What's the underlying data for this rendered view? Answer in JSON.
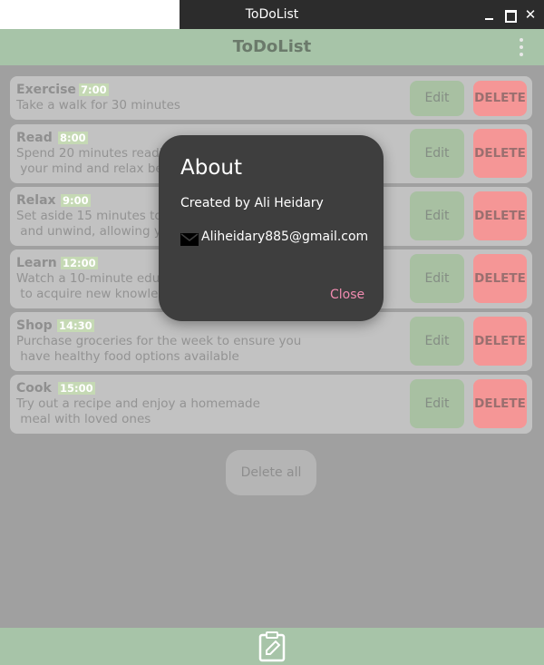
{
  "window": {
    "title": "ToDoList"
  },
  "appbar": {
    "title": "ToDoList"
  },
  "tasks": [
    {
      "title": "Exercise",
      "time": "7:00",
      "description": "Take a walk for 30 minutes"
    },
    {
      "title": "Read",
      "time": "8:00",
      "description": "Spend 20 minutes readi\n your mind and relax be"
    },
    {
      "title": "Relax",
      "time": "9:00",
      "description": "Set aside 15 minutes to\n and unwind, allowing y"
    },
    {
      "title": "Learn",
      "time": "12:00",
      "description": "Watch a 10-minute educ\n to acquire new knowlec"
    },
    {
      "title": "Shop",
      "time": "14:30",
      "description": "Purchase groceries for the week to ensure you\n have healthy food options available"
    },
    {
      "title": "Cook",
      "time": "15:00",
      "description": "Try out a recipe and enjoy a homemade\n meal with loved ones"
    }
  ],
  "buttons": {
    "edit": "Edit",
    "delete": "DELETE",
    "delete_all": "Delete all"
  },
  "dialog": {
    "title": "About",
    "created_by": "Created by Ali Heidary",
    "email": "Aliheidary885@gmail.com",
    "close": "Close"
  },
  "colors": {
    "appbar": "#a7c4a8",
    "delete": "#f59696",
    "edit": "#a8c0a2",
    "dialog_bg": "#3e3e3e",
    "close_accent": "#f08bb0"
  },
  "icons": {
    "menu": "more-vert-icon",
    "mail": "mail-icon",
    "bottom": "clipboard-edit-icon"
  }
}
